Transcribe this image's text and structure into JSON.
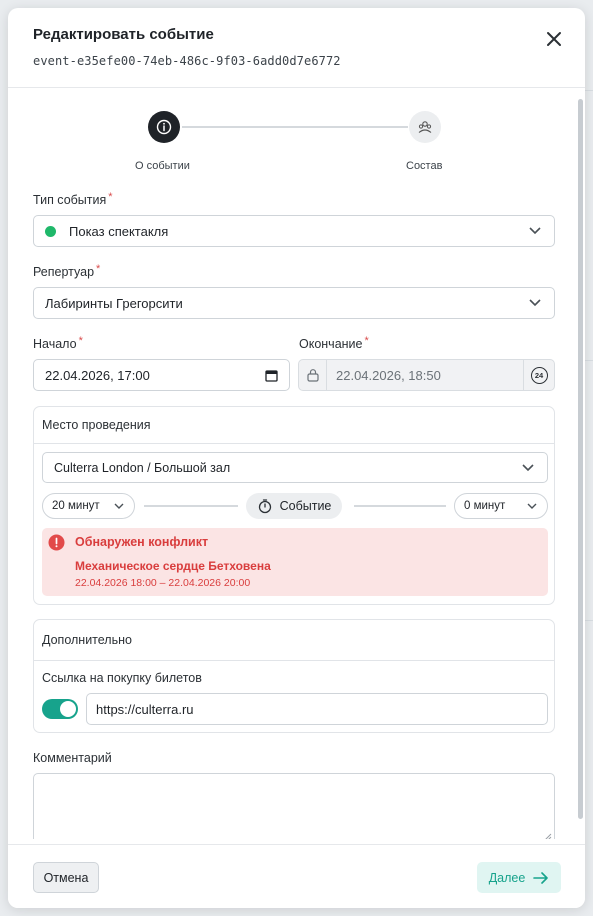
{
  "modal": {
    "title": "Редактировать событие",
    "event_id": "event-e35efe00-74eb-486c-9f03-6add0d7e6772"
  },
  "stepper": {
    "steps": [
      {
        "label": "О событии",
        "active": true,
        "icon": "info-icon"
      },
      {
        "label": "Состав",
        "active": false,
        "icon": "people-icon"
      }
    ]
  },
  "form": {
    "event_type": {
      "label": "Тип события",
      "required_mark": "*",
      "value": "Показ спектакля",
      "status_color": "#1fb86a"
    },
    "repertoire": {
      "label": "Репертуар",
      "required_mark": "*",
      "value": "Лабиринты Грегорсити"
    },
    "start": {
      "label": "Начало",
      "required_mark": "*",
      "value": "22.04.2026, 17:00"
    },
    "end": {
      "label": "Окончание",
      "required_mark": "*",
      "value": "22.04.2026, 18:50",
      "badge": "24"
    },
    "venue": {
      "title": "Место проведения",
      "value": "Culterra London / Большой зал",
      "before": "20 минут",
      "center_label": "Событие",
      "after": "0 минут",
      "conflict": {
        "title": "Обнаружен конфликт",
        "event": "Механическое сердце Бетховена",
        "time": "22.04.2026 18:00 – 22.04.2026 20:00"
      }
    },
    "extra": {
      "title": "Дополнительно",
      "ticket_link_label": "Ссылка на покупку билетов",
      "ticket_link_enabled": true,
      "ticket_link_value": "https://culterra.ru"
    },
    "comment": {
      "label": "Комментарий",
      "value": ""
    }
  },
  "footer": {
    "cancel_label": "Отмена",
    "next_label": "Далее"
  },
  "colors": {
    "accent": "#17a38c",
    "danger": "#d93d3d",
    "conflict_bg": "#fbe4e4"
  }
}
